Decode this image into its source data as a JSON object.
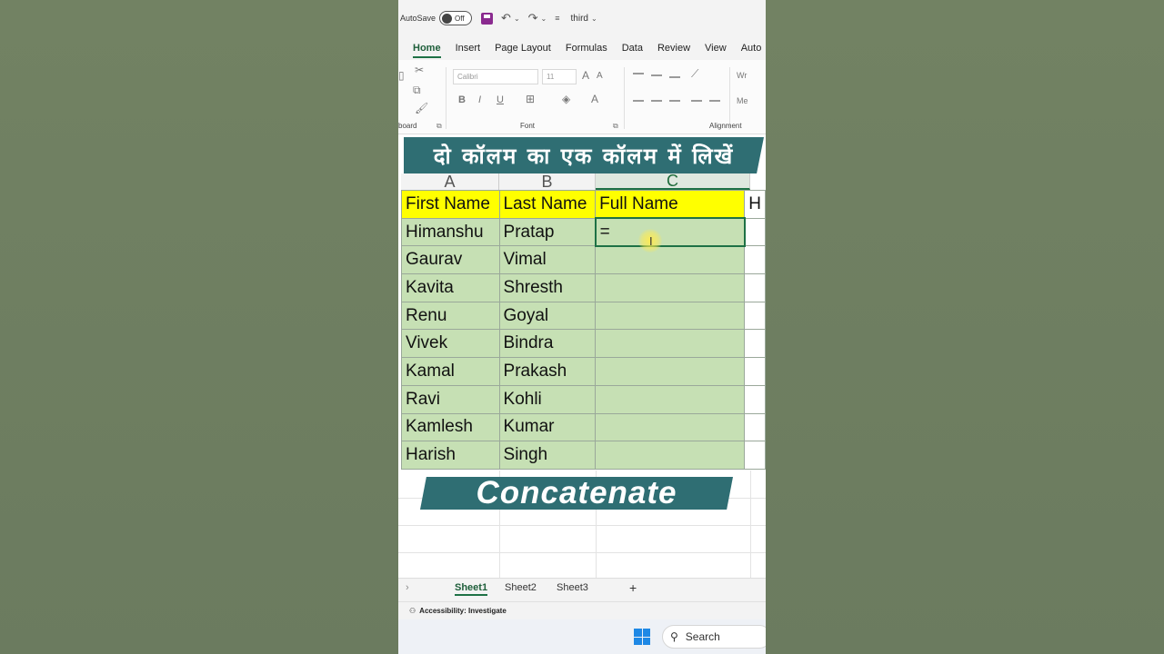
{
  "titlebar": {
    "autosave_label": "AutoSave",
    "autosave_state": "Off",
    "filename": "third"
  },
  "ribbon": {
    "tabs": [
      "Home",
      "Insert",
      "Page Layout",
      "Formulas",
      "Data",
      "Review",
      "View",
      "Auto"
    ],
    "active_tab": "Home",
    "font_name": "Calibri",
    "font_size": "11",
    "group_clipboard": "board",
    "group_font": "Font",
    "group_alignment": "Alignment",
    "bold": "B",
    "italic": "I",
    "underline": "U",
    "wrap": "Wr",
    "merge": "Me"
  },
  "banner": {
    "text": "दो कॉलम का एक कॉलम में लिखें"
  },
  "grid": {
    "col_headers": [
      "A",
      "B",
      "C"
    ],
    "header_row": {
      "a": "First Name",
      "b": "Last Name",
      "c": "Full Name",
      "d": "H"
    },
    "rows": [
      {
        "a": "Himanshu",
        "b": "Pratap",
        "c": "="
      },
      {
        "a": "Gaurav",
        "b": "Vimal",
        "c": ""
      },
      {
        "a": "Kavita",
        "b": "Shresth",
        "c": ""
      },
      {
        "a": "Renu",
        "b": "Goyal",
        "c": ""
      },
      {
        "a": "Vivek",
        "b": "Bindra",
        "c": ""
      },
      {
        "a": "Kamal",
        "b": "Prakash",
        "c": ""
      },
      {
        "a": "Ravi",
        "b": "Kohli",
        "c": ""
      },
      {
        "a": "Kamlesh",
        "b": "Kumar",
        "c": ""
      },
      {
        "a": "Harish",
        "b": "Singh",
        "c": ""
      }
    ]
  },
  "overlay": {
    "concat_label": "Concatenate"
  },
  "sheets": [
    "Sheet1",
    "Sheet2",
    "Sheet3"
  ],
  "add_sheet": "+",
  "status": {
    "accessibility": "Accessibility: Investigate"
  },
  "taskbar": {
    "search_label": "Search"
  },
  "colors": {
    "accent": "#1e7145",
    "header_fill": "#ffff00",
    "cell_fill": "#c6e0b4",
    "banner": "#2f6e73"
  }
}
